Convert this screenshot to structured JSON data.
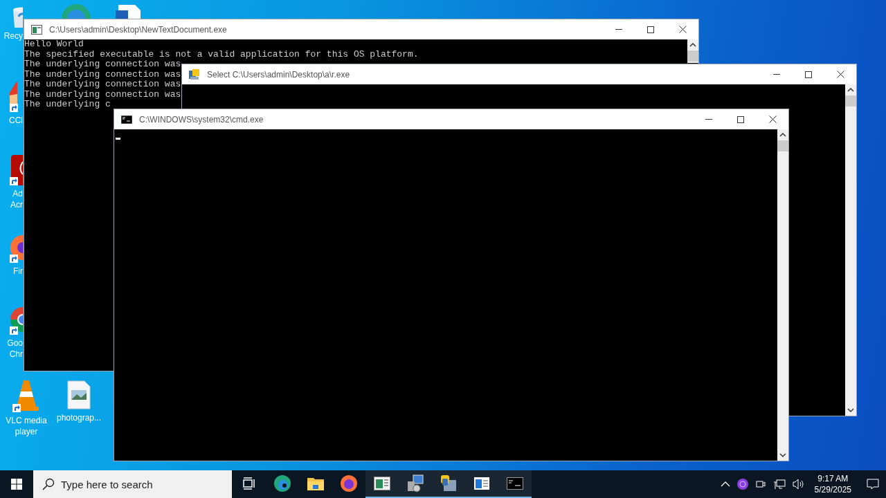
{
  "desktop_icons": [
    {
      "kind": "recycle",
      "label_lines": [
        "Recy"
      ]
    },
    {
      "kind": "edge"
    },
    {
      "kind": "document"
    },
    {
      "kind": "ccleaner",
      "label_lines": [
        "CCl"
      ]
    },
    {
      "kind": "acrobat",
      "label_lines": [
        "Ad",
        "Acr"
      ]
    },
    {
      "kind": "firefox",
      "label_lines": [
        "Fir"
      ]
    },
    {
      "kind": "chrome",
      "label_lines": [
        "Goo",
        "Chr"
      ]
    },
    {
      "kind": "vlc",
      "label_lines": [
        "VLC media",
        "player"
      ]
    },
    {
      "kind": "image",
      "label_lines": [
        "photograp..."
      ]
    }
  ],
  "windows": [
    {
      "kind": "app",
      "title": "C:\\Users\\admin\\Desktop\\NewTextDocument.exe",
      "lines": [
        "Hello World",
        "The specified executable is not a valid application for this OS platform.",
        "The underlying connection was",
        "The underlying connection was",
        "The underlying connection was",
        "The underlying connection was",
        "The underlying c"
      ],
      "cursor": false
    },
    {
      "kind": "python",
      "title": "Select C:\\Users\\admin\\Desktop\\a\\r.exe",
      "cursor": false
    },
    {
      "kind": "cmd",
      "title": "C:\\WINDOWS\\system32\\cmd.exe",
      "cursor": true
    }
  ],
  "taskbar": {
    "search": {
      "placeholder": "Type here to search"
    },
    "apps": [
      {
        "kind": "taskview",
        "running": false
      },
      {
        "kind": "edge",
        "running": false
      },
      {
        "kind": "explorer",
        "running": false
      },
      {
        "kind": "firefox",
        "running": false
      },
      {
        "kind": "app",
        "running": true
      },
      {
        "kind": "installer",
        "running": true
      },
      {
        "kind": "python",
        "running": true
      },
      {
        "kind": "window",
        "running": true
      },
      {
        "kind": "cmd",
        "running": true
      }
    ],
    "time": "9:17 AM",
    "date": "5/29/2025"
  }
}
